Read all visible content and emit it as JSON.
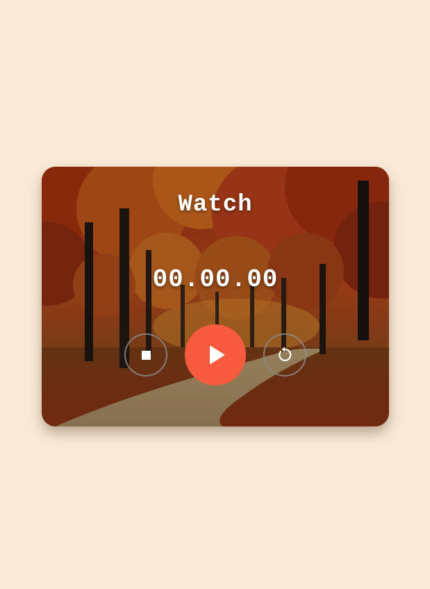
{
  "app": {
    "title": "Watch",
    "display": "00.00.00"
  },
  "controls": {
    "stop_icon": "stop-icon",
    "play_icon": "play-icon",
    "reset_icon": "reset-icon"
  },
  "colors": {
    "page_background": "#f9ead7",
    "play_button": "#f85a3e",
    "text": "#ffffff"
  }
}
